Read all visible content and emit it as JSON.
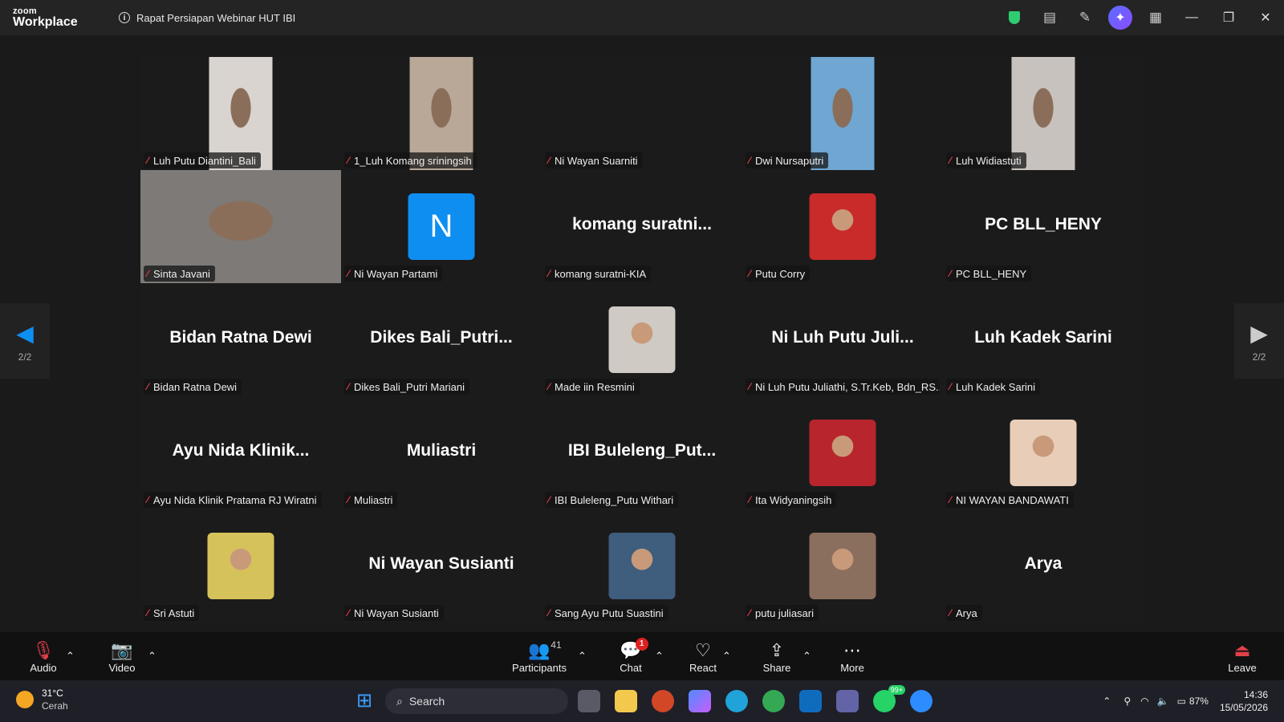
{
  "titlebar": {
    "brand_top": "zoom",
    "brand_bottom": "Workplace",
    "meeting_title": "Rapat Persiapan Webinar HUT IBI"
  },
  "participants_grid": [
    {
      "label": "Luh Putu Diantini_Bali",
      "kind": "video",
      "color": "#d9d4cf"
    },
    {
      "label": "1_Luh Komang sriningsih",
      "kind": "video",
      "color": "#b9a898"
    },
    {
      "label": "Ni Wayan Suarniti",
      "kind": "empty"
    },
    {
      "label": "Dwi Nursaputri",
      "kind": "video",
      "color": "#6fa6d2"
    },
    {
      "label": "Luh Widiastuti",
      "kind": "video",
      "color": "#c8c2be"
    },
    {
      "label": "Sinta Javani",
      "kind": "video-wide",
      "color": "#7d7a77"
    },
    {
      "label": "Ni Wayan Partami",
      "kind": "letter",
      "letter": "N"
    },
    {
      "label": "komang suratni-KIA",
      "kind": "text",
      "display": "komang  suratni..."
    },
    {
      "label": "Putu Corry",
      "kind": "photo",
      "color": "#c92a2a"
    },
    {
      "label": "PC BLL_HENY",
      "kind": "text",
      "display": "PC BLL_HENY"
    },
    {
      "label": "Bidan Ratna Dewi",
      "kind": "text",
      "display": "Bidan Ratna Dewi"
    },
    {
      "label": "Dikes Bali_Putri Mariani",
      "kind": "text",
      "display": "Dikes  Bali_Putri..."
    },
    {
      "label": "Made iin Resmini",
      "kind": "photo",
      "color": "#cfcac4"
    },
    {
      "label": "Ni Luh Putu Juliathi, S.Tr.Keb, Bdn_RS...",
      "kind": "text",
      "display": "Ni  Luh  Putu  Juli..."
    },
    {
      "label": "Luh Kadek Sarini",
      "kind": "text",
      "display": "Luh Kadek Sarini"
    },
    {
      "label": "Ayu Nida Klinik Pratama RJ Wiratni",
      "kind": "text",
      "display": "Ayu  Nida  Klinik..."
    },
    {
      "label": "Muliastri",
      "kind": "text",
      "display": "Muliastri"
    },
    {
      "label": "IBI Buleleng_Putu Withari",
      "kind": "text",
      "display": "IBI  Buleleng_Put..."
    },
    {
      "label": "Ita Widyaningsih",
      "kind": "photo",
      "color": "#b8252d"
    },
    {
      "label": "NI WAYAN BANDAWATI",
      "kind": "photo",
      "color": "#e8cdb8"
    },
    {
      "label": "Sri Astuti",
      "kind": "photo",
      "color": "#d6c25a"
    },
    {
      "label": "Ni Wayan Susianti",
      "kind": "text",
      "display": "Ni Wayan Susianti"
    },
    {
      "label": "Sang Ayu Putu Suastini",
      "kind": "photo",
      "color": "#3f5d7d"
    },
    {
      "label": "putu juliasari",
      "kind": "photo",
      "color": "#8b6f5e"
    },
    {
      "label": "Arya",
      "kind": "text",
      "display": "Arya"
    }
  ],
  "pager": {
    "left": "2/2",
    "right": "2/2"
  },
  "toolbar": {
    "audio": "Audio",
    "video": "Video",
    "participants": "Participants",
    "participants_count": "41",
    "chat": "Chat",
    "chat_badge": "1",
    "react": "React",
    "share": "Share",
    "more": "More",
    "leave": "Leave"
  },
  "taskbar": {
    "temp": "31°C",
    "weather": "Cerah",
    "search": "Search",
    "whatsapp_badge": "99+",
    "battery": "87%",
    "time": "14:36",
    "date": "15/05/2026"
  }
}
